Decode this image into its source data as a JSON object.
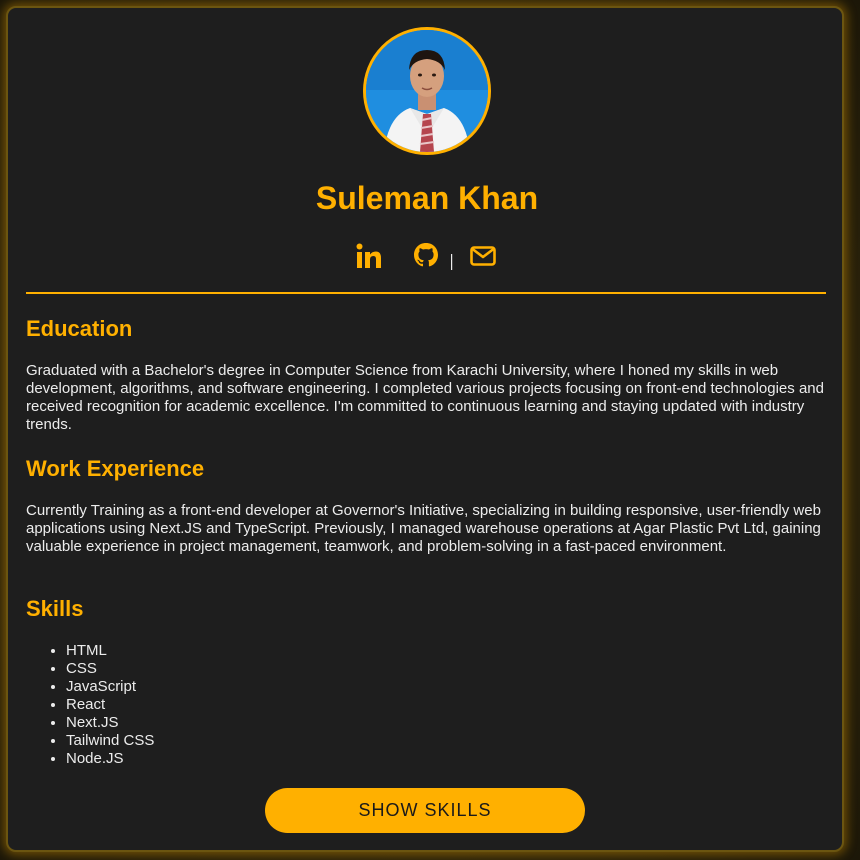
{
  "profile": {
    "name": "Suleman Khan",
    "avatar_alt": "profile photo"
  },
  "socials": [
    {
      "icon": "linkedin-icon"
    },
    {
      "icon": "github-icon"
    },
    {
      "icon": "mail-icon"
    }
  ],
  "separator": "|",
  "education": {
    "heading": "Education",
    "text": "Graduated with a Bachelor's degree in Computer Science from Karachi University, where I honed my skills in web development, algorithms, and software engineering. I completed various projects focusing on front-end technologies and received recognition for academic excellence. I'm committed to continuous learning and staying updated with industry trends."
  },
  "experience": {
    "heading": "Work Experience",
    "text": "Currently Training as a front-end developer at Governor's Initiative, specializing in building responsive, user-friendly web applications using Next.JS and TypeScript. Previously, I managed warehouse operations at Agar Plastic Pvt Ltd, gaining valuable experience in project management, teamwork, and problem-solving in a fast-paced environment."
  },
  "skills": {
    "heading": "Skills",
    "items": [
      "HTML",
      "CSS",
      "JavaScript",
      "React",
      "Next.JS",
      "Tailwind CSS",
      "Node.JS"
    ],
    "button_label": "SHOW SKILLS"
  },
  "colors": {
    "accent": "#ffb000",
    "card_background": "#1e1e1e",
    "text": "#ececec"
  }
}
